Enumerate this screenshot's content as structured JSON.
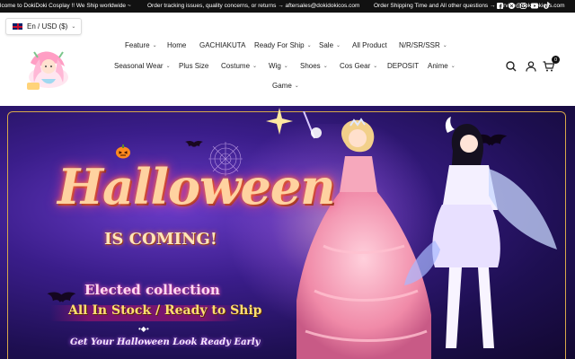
{
  "announcement": {
    "messages": [
      "lcome to DokiDoki Cosplay !! We Ship worldwide ~",
      "Order tracking issues, quality concerns, or returns → aftersales@dokidokicos.com",
      "Order Shipping Time and All other questions → service@dokidokicos.com"
    ],
    "socials": [
      "facebook-icon",
      "x-icon",
      "instagram-icon",
      "youtube-icon",
      "tiktok-icon"
    ]
  },
  "header": {
    "currency_label": "En / USD ($)",
    "cart_count": "0"
  },
  "nav": {
    "row1": [
      {
        "label": "Feature",
        "dropdown": true
      },
      {
        "label": "Home",
        "dropdown": false
      },
      {
        "label": "GACHIAKUTA",
        "dropdown": false
      },
      {
        "label": "Ready For Ship",
        "dropdown": true
      },
      {
        "label": "Sale",
        "dropdown": true
      },
      {
        "label": "All Product",
        "dropdown": false
      },
      {
        "label": "N/R/SR/SSR",
        "dropdown": true
      }
    ],
    "row2": [
      {
        "label": "Seasonal Wear",
        "dropdown": true
      },
      {
        "label": "Plus Size",
        "dropdown": false
      },
      {
        "label": "Costume",
        "dropdown": true
      },
      {
        "label": "Wig",
        "dropdown": true
      },
      {
        "label": "Shoes",
        "dropdown": true
      },
      {
        "label": "Cos Gear",
        "dropdown": true
      },
      {
        "label": "DEPOSIT",
        "dropdown": false
      },
      {
        "label": "Anime",
        "dropdown": true
      }
    ],
    "row3": [
      {
        "label": "Game",
        "dropdown": true
      }
    ]
  },
  "hero": {
    "headline": "Halloween",
    "subheadline": "IS COMING!",
    "collection": "Elected collection",
    "stock": "All In Stock / Ready to Ship",
    "dots": "•◆•",
    "tagline": "Get Your Halloween Look Ready Early"
  },
  "colors": {
    "topbar": "#111111",
    "hero_purple": "#3a1d8a",
    "gold": "#d8a84a"
  }
}
